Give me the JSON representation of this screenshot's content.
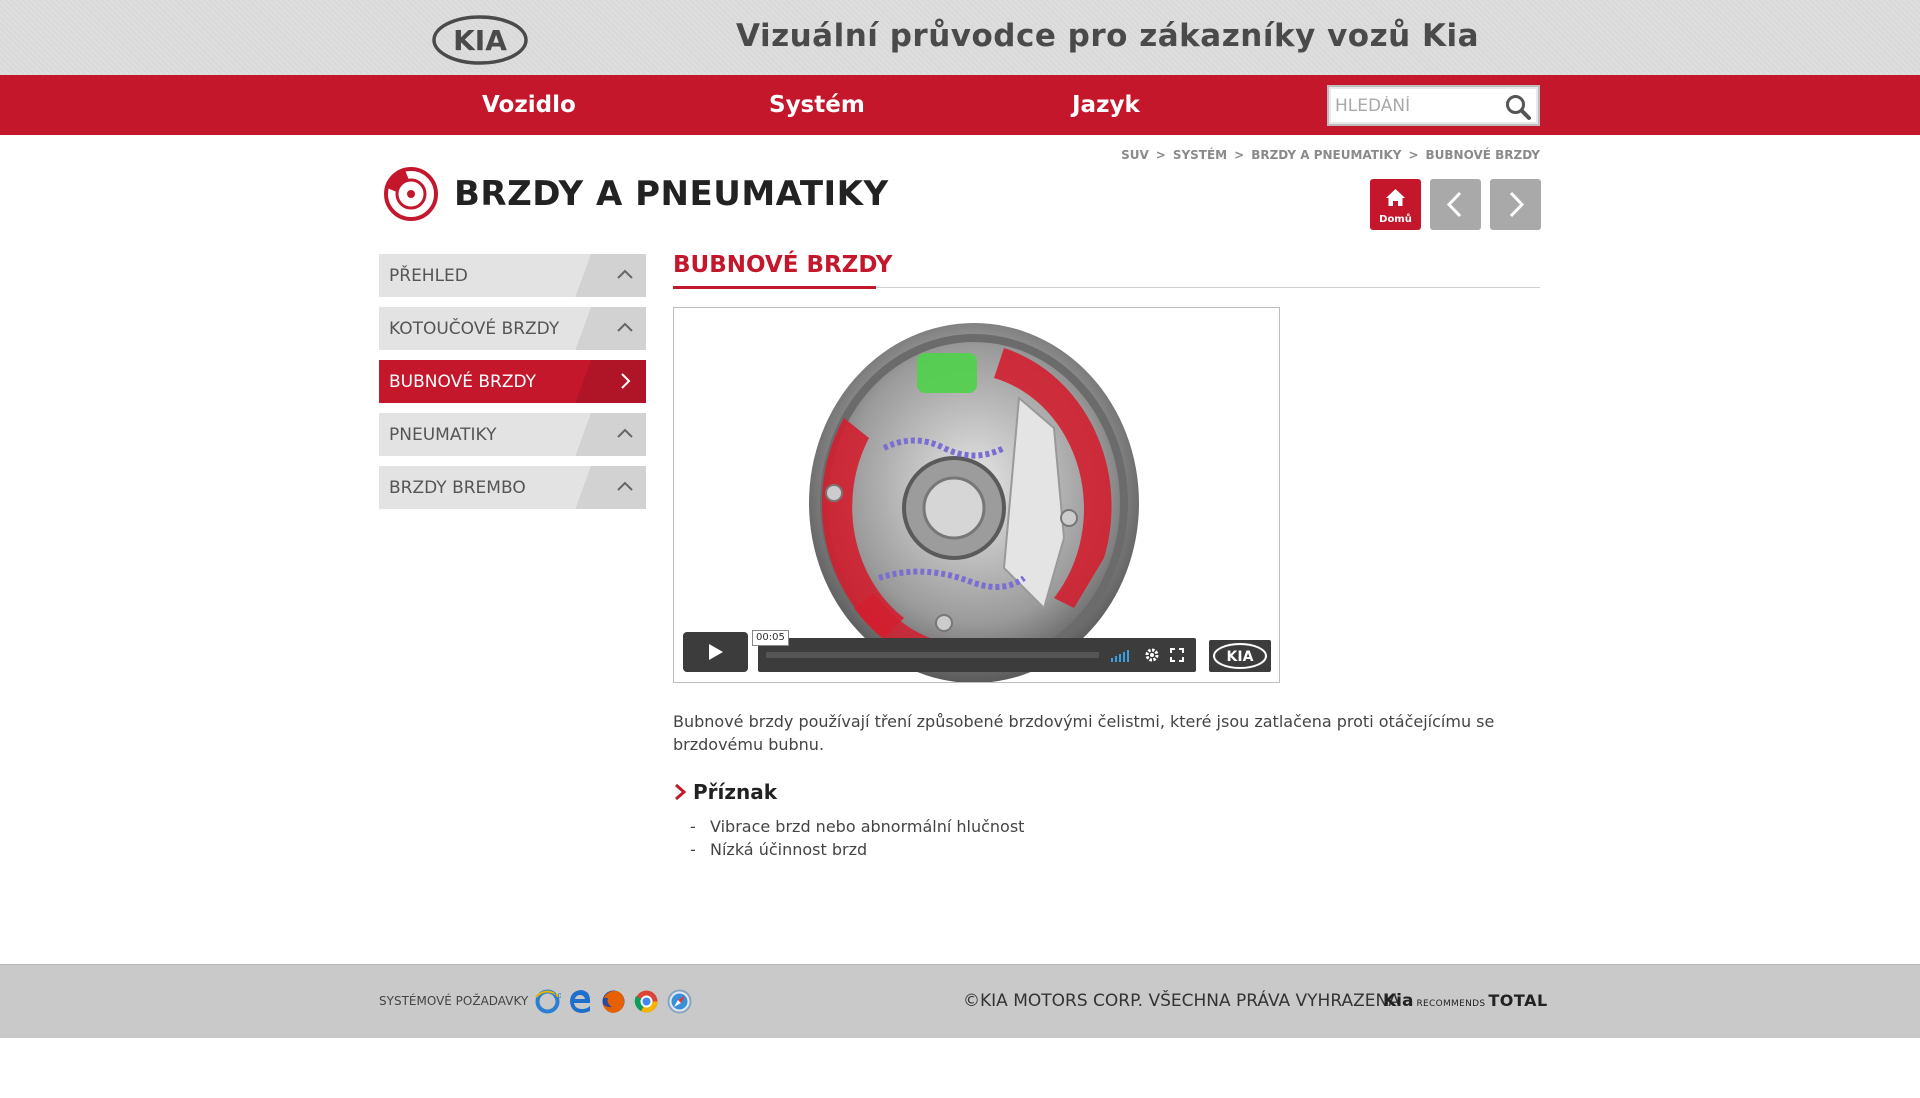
{
  "header": {
    "logo_text": "KIA",
    "title": "Vizuální průvodce pro zákazníky vozů Kia"
  },
  "nav": {
    "items": [
      "Vozidlo",
      "Systém",
      "Jazyk"
    ],
    "search_placeholder": "HLEDÁNÍ"
  },
  "breadcrumb": [
    "SUV",
    "SYSTÉM",
    "BRZDY A PNEUMATIKY",
    "BUBNOVÉ BRZDY"
  ],
  "breadcrumb_sep": ">",
  "section": {
    "title": "BRZDY A PNEUMATIKY",
    "home_label": "Domů"
  },
  "sidebar": {
    "items": [
      {
        "label": "PŘEHLED",
        "active": false
      },
      {
        "label": "KOTOUČOVÉ BRZDY",
        "active": false
      },
      {
        "label": "BUBNOVÉ BRZDY",
        "active": true
      },
      {
        "label": "PNEUMATIKY",
        "active": false
      },
      {
        "label": "BRZDY BREMBO",
        "active": false
      }
    ]
  },
  "content": {
    "title": "BUBNOVÉ BRZDY",
    "video": {
      "time": "00:05",
      "logo_text": "KIA"
    },
    "description": "Bubnové brzdy používají tření způsobené brzdovými čelistmi, které jsou zatlačena proti otáčejícímu se brzdovému bubnu.",
    "symptom_heading": "Příznak",
    "symptoms": [
      "Vibrace brzd nebo abnormální hlučnost",
      "Nízká účinnost brzd"
    ]
  },
  "footer": {
    "sys_req": "SYSTÉMOVÉ POŽADAVKY",
    "copyright": "©KIA MOTORS CORP. VŠECHNA PRÁVA VYHRAZENA",
    "kia": "Kia",
    "recommends": "RECOMMENDS",
    "total": "TOTAL"
  },
  "colors": {
    "brand_red": "#c4172c",
    "nav_grey": "#a9a9a9"
  }
}
